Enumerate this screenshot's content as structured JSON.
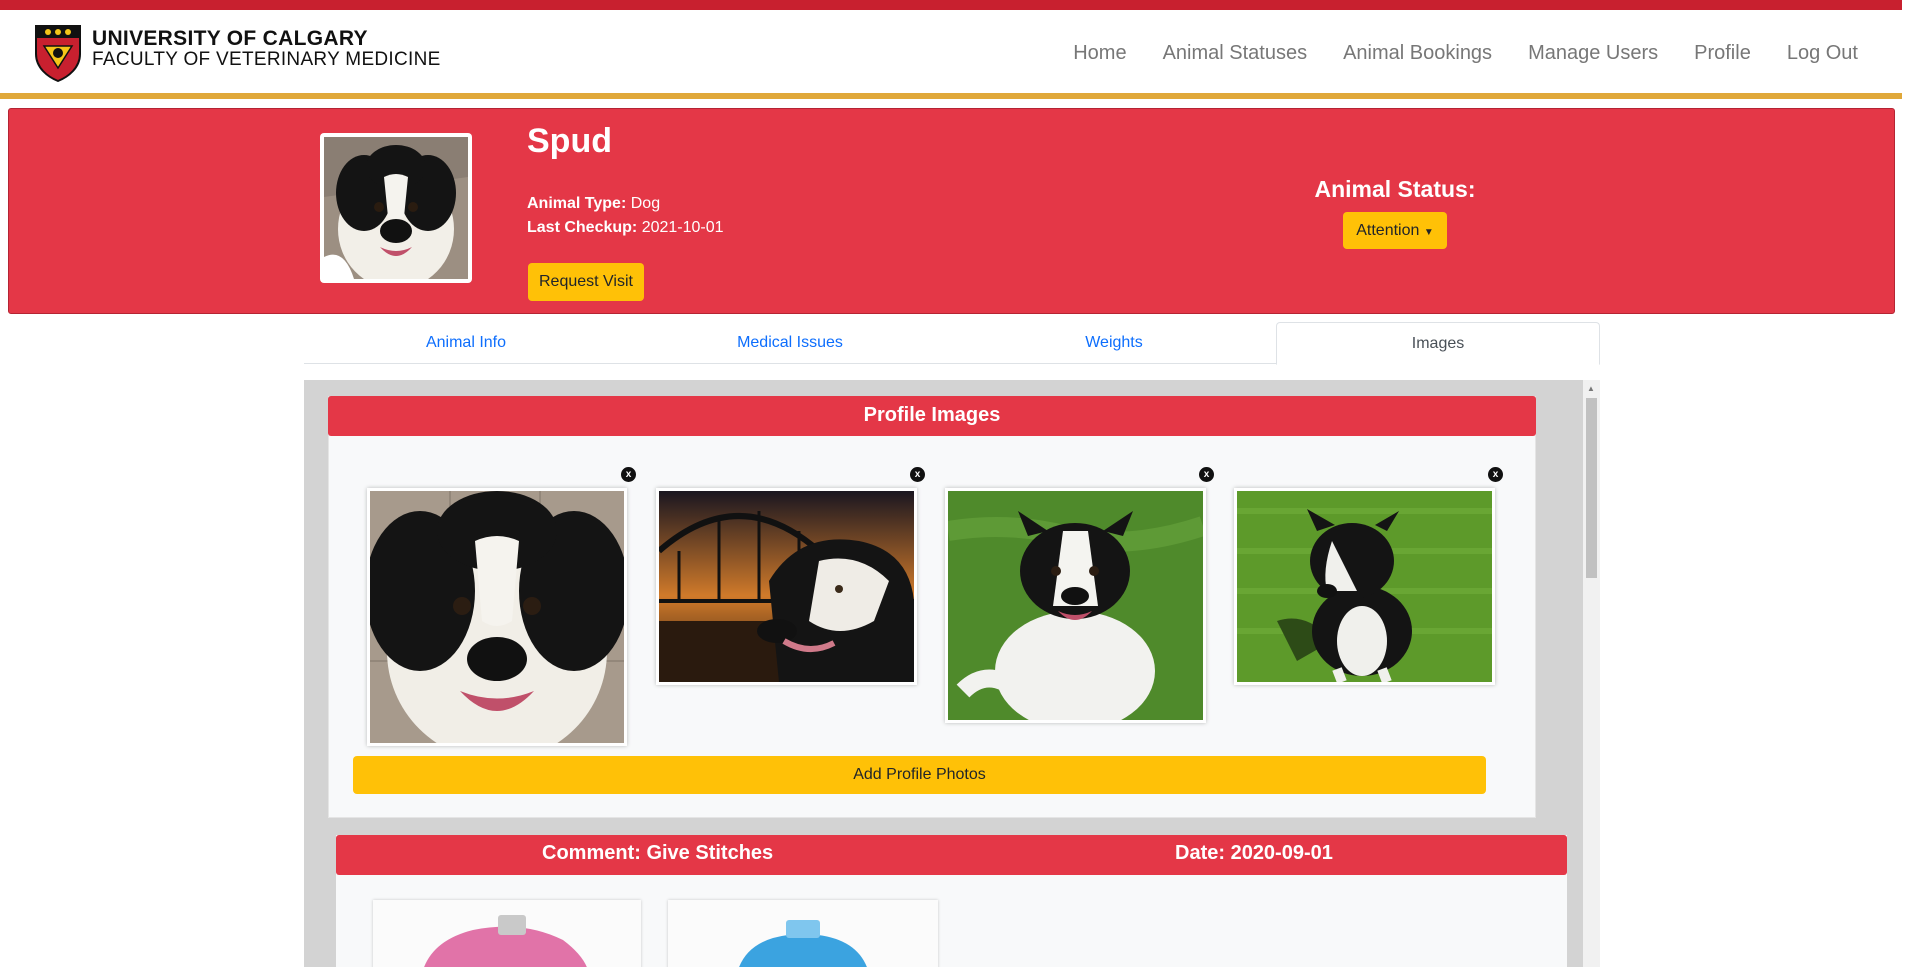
{
  "brand": {
    "line1": "UNIVERSITY OF CALGARY",
    "line2": "FACULTY OF VETERINARY MEDICINE"
  },
  "nav": {
    "items": [
      "Home",
      "Animal Statuses",
      "Animal Bookings",
      "Manage Users",
      "Profile",
      "Log Out"
    ]
  },
  "animal": {
    "name": "Spud",
    "type_label": "Animal Type:",
    "type_value": "Dog",
    "checkup_label": "Last Checkup:",
    "checkup_value": "2021-10-01",
    "request_visit": "Request Visit",
    "status_label": "Animal Status:",
    "status_value": "Attention"
  },
  "tabs": [
    "Animal Info",
    "Medical Issues",
    "Weights",
    "Images"
  ],
  "active_tab": "Images",
  "profile_images": {
    "title": "Profile Images",
    "close_glyph": "x",
    "add_button": "Add Profile Photos"
  },
  "comment_card": {
    "comment": "Comment: Give Stitches",
    "date": "Date: 2020-09-01"
  },
  "colors": {
    "brand_red": "#e43747",
    "topbar_red": "#c8202f",
    "gold_line": "#e0a83a",
    "button_yellow": "#ffc107",
    "link_blue": "#0d6efd"
  }
}
